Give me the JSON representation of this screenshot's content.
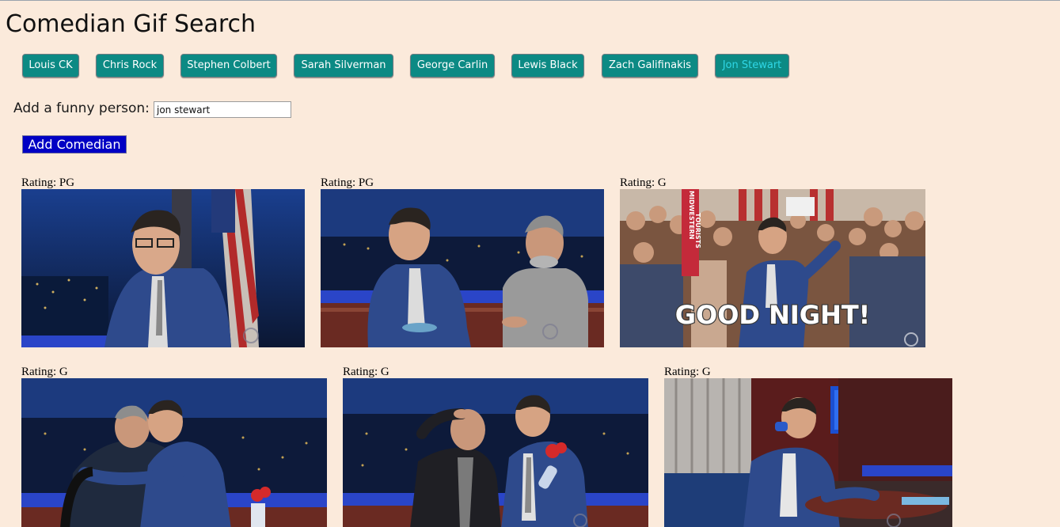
{
  "page": {
    "title": "Comedian Gif Search"
  },
  "comedians": [
    {
      "label": "Louis CK",
      "active": false
    },
    {
      "label": "Chris Rock",
      "active": false
    },
    {
      "label": "Stephen Colbert",
      "active": false
    },
    {
      "label": "Sarah Silverman",
      "active": false
    },
    {
      "label": "George Carlin",
      "active": false
    },
    {
      "label": "Lewis Black",
      "active": false
    },
    {
      "label": "Zach Galifinakis",
      "active": false
    },
    {
      "label": "Jon Stewart",
      "active": true
    }
  ],
  "form": {
    "label": "Add a funny person:",
    "input_value": "jon stewart",
    "button_label": "Add Comedian"
  },
  "gifs": [
    {
      "rating": "Rating: PG",
      "scene": "colbert-desk-flag"
    },
    {
      "rating": "Rating: PG",
      "scene": "colbert-stewart-desk"
    },
    {
      "rating": "Rating: G",
      "scene": "crowd-good-night",
      "caption": "GOOD NIGHT!",
      "signs": [
        "MIDWESTERN",
        "TOURISTS"
      ]
    },
    {
      "rating": "Rating: G",
      "scene": "hug"
    },
    {
      "rating": "Rating: G",
      "scene": "salute-flowers"
    },
    {
      "rating": "Rating: G",
      "scene": "colbert-drinking"
    }
  ],
  "colors": {
    "page_background": "#fbeadb",
    "comedian_button": "#0c8a84",
    "comedian_button_active_text": "#2fd7e6",
    "add_button": "#0000c4"
  }
}
